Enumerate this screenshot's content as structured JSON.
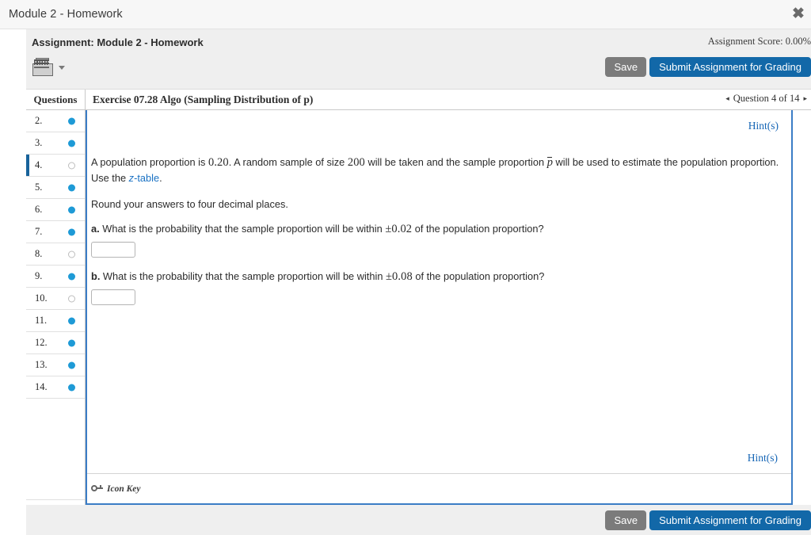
{
  "window": {
    "title": "Module 2 - Homework",
    "close_icon": "close-icon"
  },
  "assignment": {
    "title": "Assignment: Module 2 - Homework",
    "score": "Assignment Score: 0.00%",
    "calculator_icon": "calculator-keyboard-icon",
    "save_label": "Save",
    "submit_label": "Submit Assignment for Grading"
  },
  "table": {
    "questions_header": "Questions",
    "exercise_title": "Exercise 07.28 Algo (Sampling Distribution of p)",
    "nav": {
      "prev_icon": "◂",
      "label": "Question 4 of 14",
      "next_icon": "▸"
    }
  },
  "sidebar": {
    "items": [
      {
        "label": "2.",
        "status": "filled"
      },
      {
        "label": "3.",
        "status": "filled"
      },
      {
        "label": "4.",
        "status": "empty"
      },
      {
        "label": "5.",
        "status": "filled"
      },
      {
        "label": "6.",
        "status": "filled"
      },
      {
        "label": "7.",
        "status": "filled"
      },
      {
        "label": "8.",
        "status": "empty"
      },
      {
        "label": "9.",
        "status": "filled"
      },
      {
        "label": "10.",
        "status": "empty"
      },
      {
        "label": "11.",
        "status": "filled"
      },
      {
        "label": "12.",
        "status": "filled"
      },
      {
        "label": "13.",
        "status": "filled"
      },
      {
        "label": "14.",
        "status": "filled"
      }
    ],
    "selected_index": 2
  },
  "question": {
    "hint_label": "Hint(s)",
    "stem": {
      "t1": "A population proportion is ",
      "p_value": "0.20",
      "t2": ". A random sample of size ",
      "n_value": "200",
      "t3": " will be taken and the sample proportion ",
      "pbar": "p",
      "t4": " will be used to estimate the population proportion. Use the ",
      "link_prefix": "z",
      "link_suffix": "-table",
      "t5": "."
    },
    "round_note": "Round your answers to four decimal places.",
    "parts": [
      {
        "letter": "a.",
        "text_before": " What is the probability that the sample proportion will be within ",
        "math": "±0.02",
        "text_after": " of the population proportion?",
        "answer_value": "",
        "answer_placeholder": ""
      },
      {
        "letter": "b.",
        "text_before": " What is the probability that the sample proportion will be within ",
        "math": "±0.08",
        "text_after": " of the population proportion?",
        "answer_value": "",
        "answer_placeholder": ""
      }
    ],
    "icon_key_label": "Icon Key",
    "icon_key_icon": "key-icon"
  },
  "colors": {
    "accent_blue": "#1268a8",
    "link_blue": "#1565b5",
    "panel_border": "#3b7dc6",
    "dot_filled": "#1e9ad6",
    "save_gray": "#7b7b7b",
    "header_bg": "#efefef"
  }
}
